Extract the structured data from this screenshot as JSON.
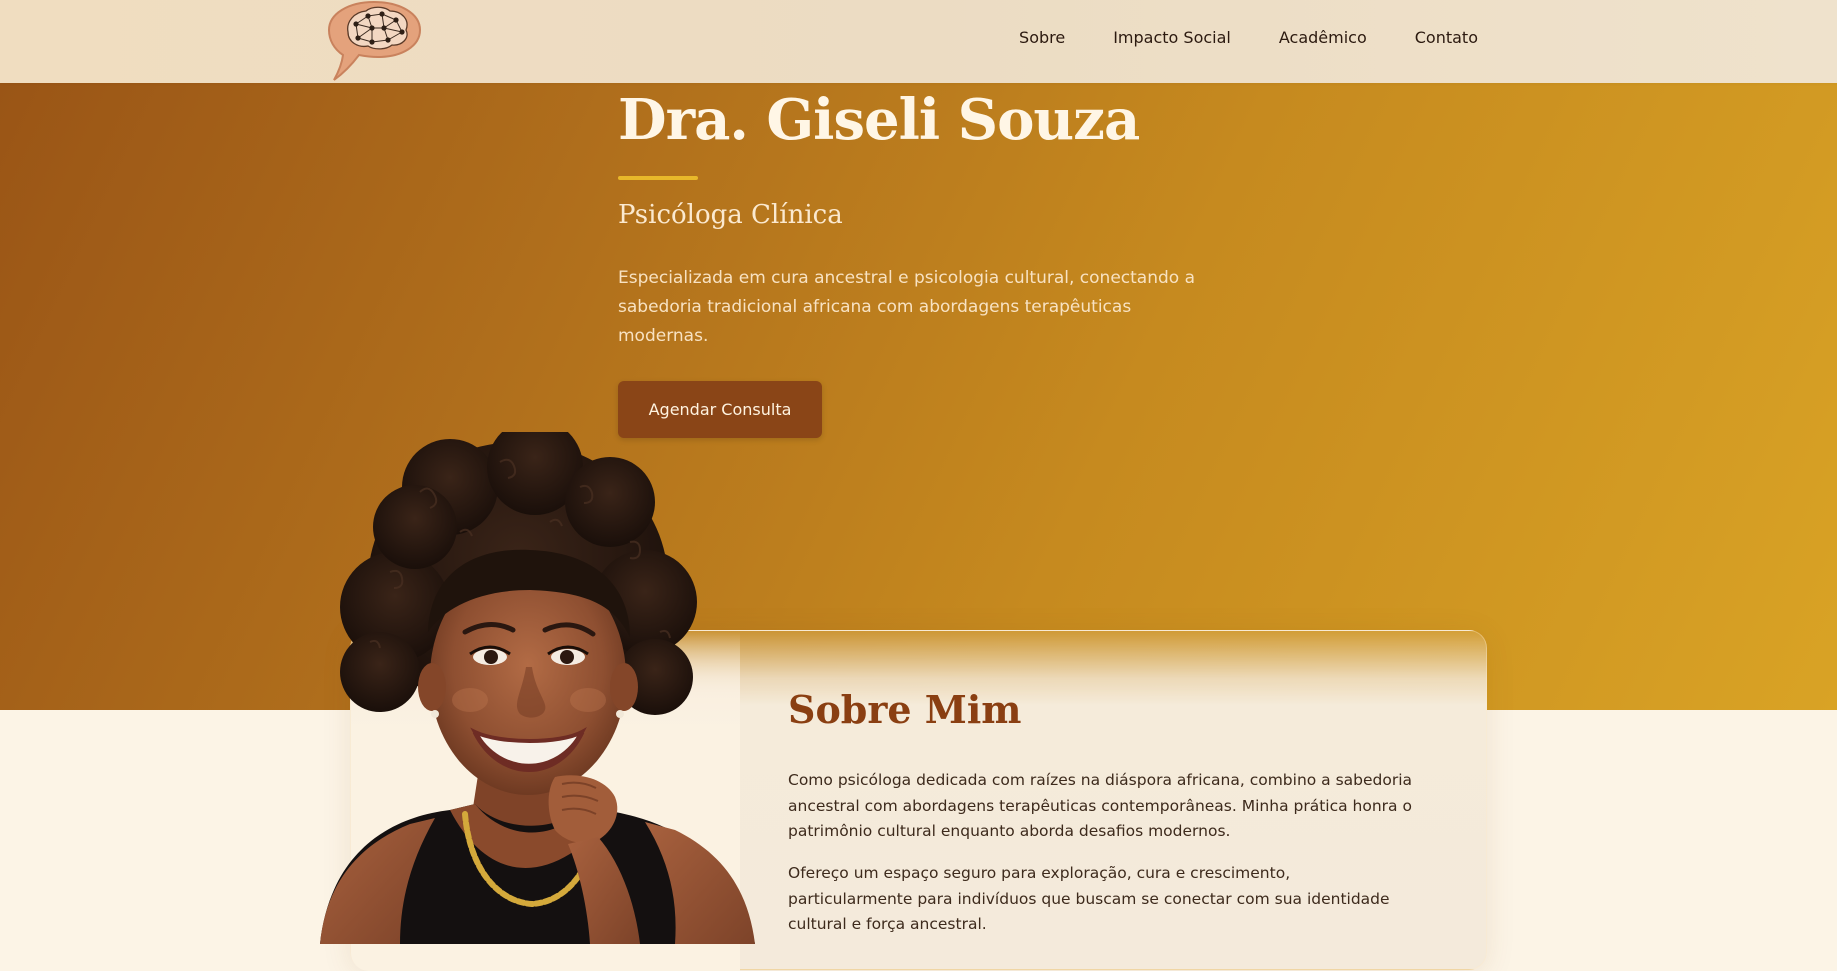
{
  "nav": {
    "logo_icon": "brain-network-speech-bubble-icon",
    "links": [
      {
        "label": "Sobre"
      },
      {
        "label": "Impacto Social"
      },
      {
        "label": "Acadêmico"
      },
      {
        "label": "Contato"
      }
    ]
  },
  "hero": {
    "title": "Dra. Giseli Souza",
    "subtitle": "Psicóloga Clínica",
    "description": "Especializada em cura ancestral e psicologia cultural, conectando a sabedoria tradicional africana com abordagens terapêuticas modernas.",
    "cta_label": "Agendar Consulta"
  },
  "about": {
    "title": "Sobre Mim",
    "paragraphs": [
      "Como psicóloga dedicada com raízes na diáspora africana, combino a sabedoria ancestral com abordagens terapêuticas contemporâneas. Minha prática honra o patrimônio cultural enquanto aborda desafios modernos.",
      "Ofereço um espaço seguro para exploração, cura e crescimento, particularmente para indivíduos que buscam se conectar com sua identidade cultural e força ancestral."
    ]
  },
  "colors": {
    "nav_bg": "#ecdcc3",
    "hero_start": "#9a5516",
    "hero_end": "#d9a325",
    "accent_rule": "#e8b82a",
    "cta_bg": "#8a4517",
    "about_title": "#8a3f12",
    "page_bg": "#fcf4e6"
  }
}
